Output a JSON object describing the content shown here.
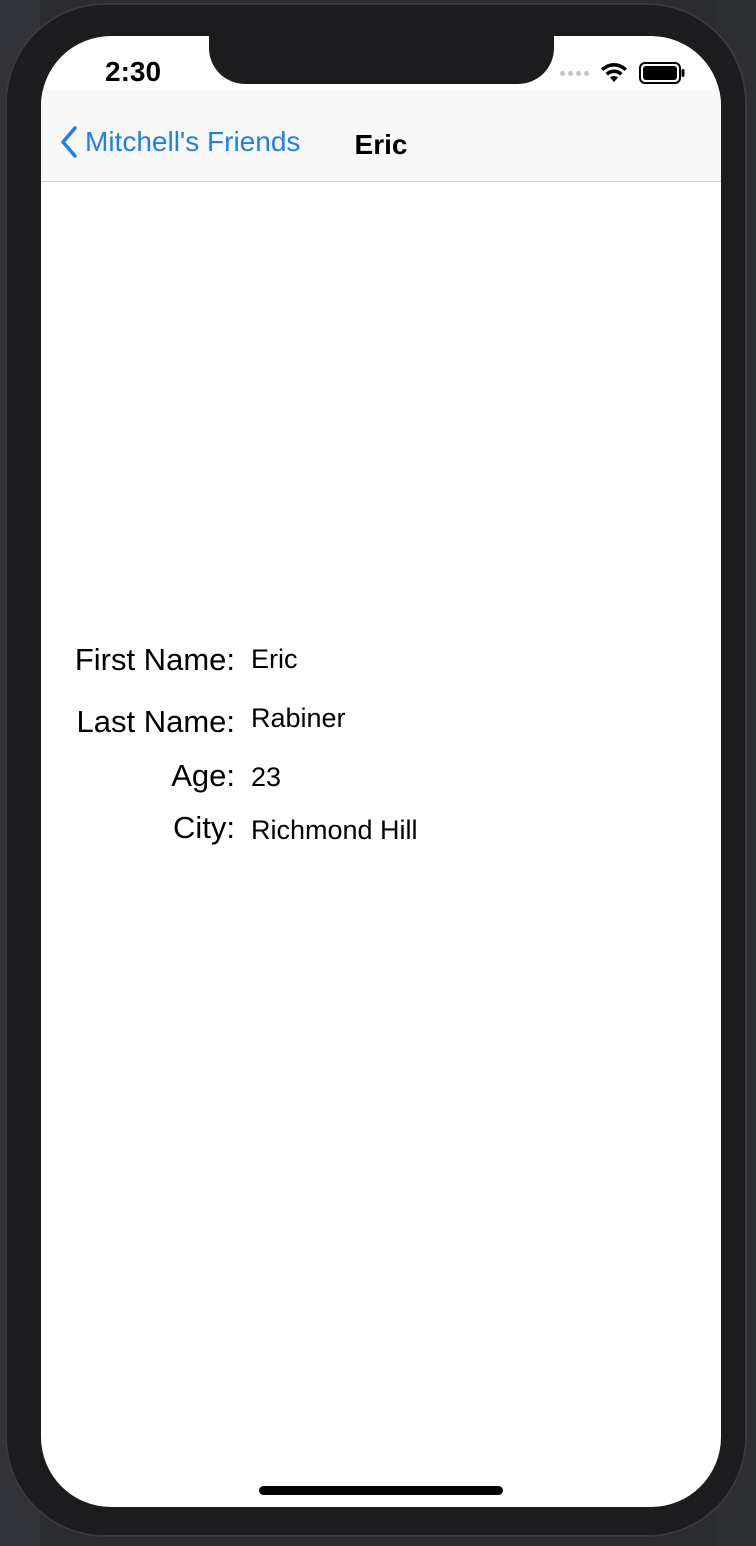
{
  "status_bar": {
    "time": "2:30",
    "icons": [
      "signal-dots-icon",
      "wifi-icon",
      "battery-icon"
    ]
  },
  "nav_bar": {
    "back_label": "Mitchell's Friends",
    "title": "Eric"
  },
  "detail": {
    "fields": [
      {
        "label": "First Name:",
        "value": "Eric"
      },
      {
        "label": "Last Name:",
        "value": "Rabiner"
      },
      {
        "label": "Age:",
        "value": "23"
      },
      {
        "label": "City:",
        "value": "Richmond Hill"
      }
    ]
  },
  "colors": {
    "accent": "#1f7ef0",
    "navbar_bg": "#f8f8f8",
    "device_bezel": "#1c1c1e",
    "background": "#2b2c30"
  }
}
